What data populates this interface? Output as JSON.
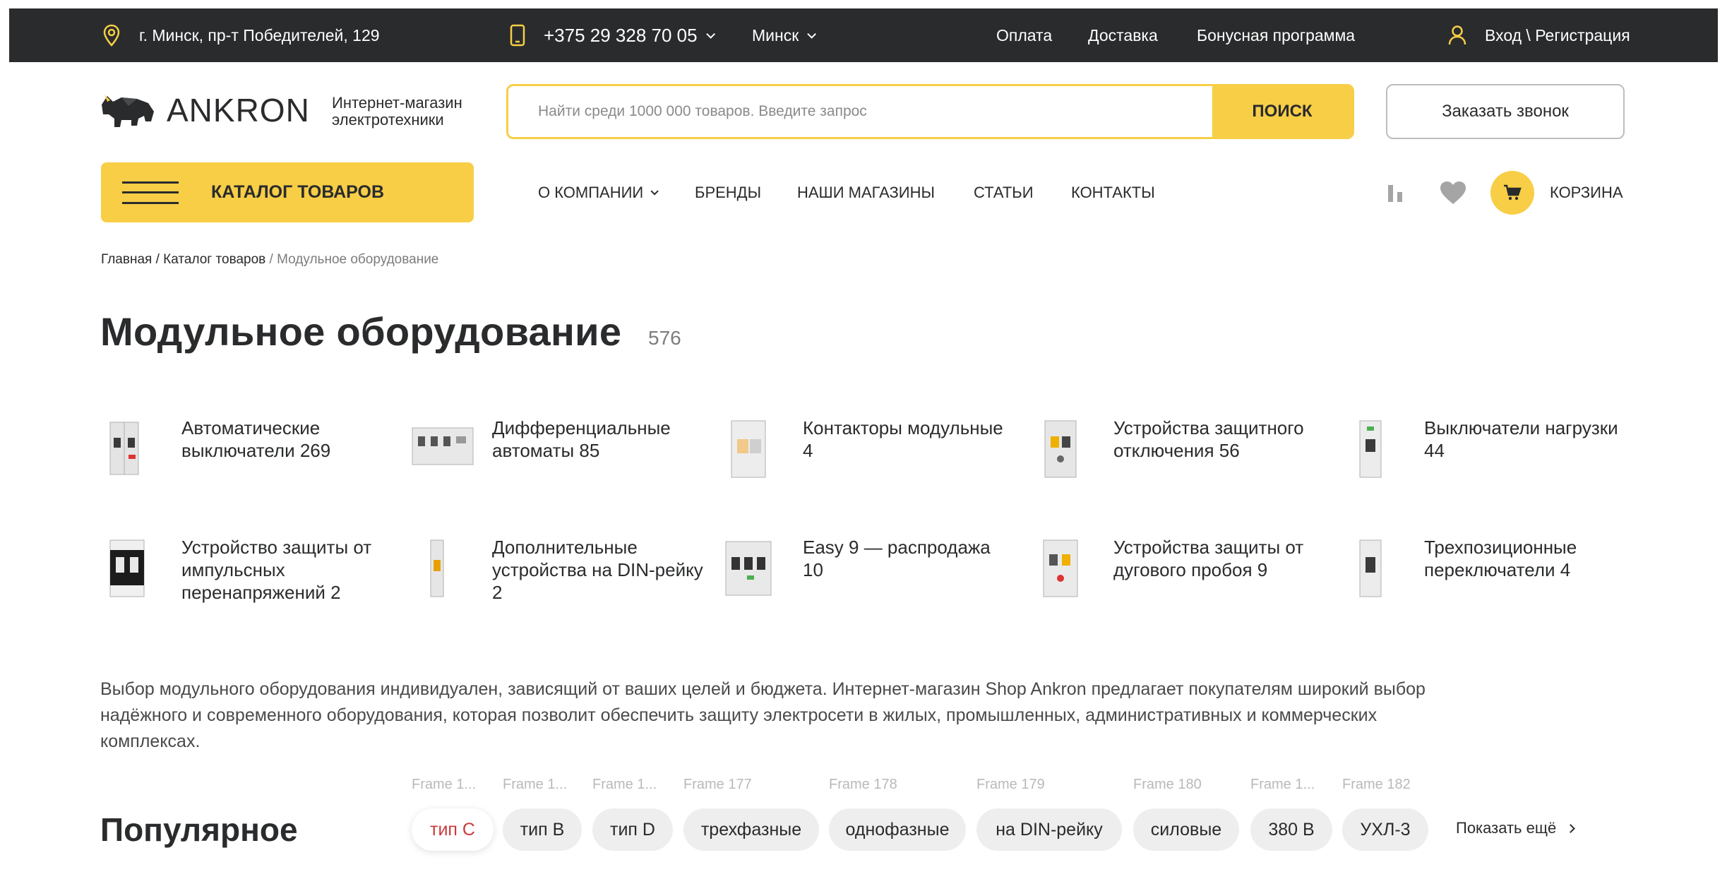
{
  "topbar": {
    "address": "г. Минск, пр-т Победителей, 129",
    "phone": "+375 29 328 70 05",
    "city": "Минск",
    "links": [
      "Оплата",
      "Доставка",
      "Бонусная программа"
    ],
    "account": "Вход \\ Регистрация"
  },
  "header": {
    "logo_text": "ANKRON",
    "tagline_1": "Интернет-магазин",
    "tagline_2": "электротехники",
    "search_placeholder": "Найти среди 1000 000 товаров. Введите запрос",
    "search_button": "ПОИСК",
    "callback_button": "Заказать звонок"
  },
  "nav": {
    "catalog": "КАТАЛОГ ТОВАРОВ",
    "items": [
      "О КОМПАНИИ",
      "БРЕНДЫ",
      "НАШИ МАГАЗИНЫ",
      "СТАТЬИ",
      "КОНТАКТЫ"
    ],
    "cart": "КОРЗИНА"
  },
  "breadcrumb": {
    "home": "Главная",
    "catalog": "Каталог товаров",
    "current": "Модульное оборудование"
  },
  "page": {
    "title": "Модульное оборудование",
    "count": "576"
  },
  "categories": [
    "Автоматические выключатели 269",
    "Дифференциальные автоматы 85",
    "Контакторы модульные 4",
    "Устройства защитного отключения 56",
    "Выключатели нагрузки 44",
    "Устройство защиты от импульсных перенапряжений 2",
    "Дополнительные устройства на DIN-рейку 2",
    "Easy 9 — распродажа 10",
    "Устройства защиты от дугового пробоя 9",
    "Трехпозиционные переключатели 4"
  ],
  "description": "Выбор модульного оборудования индивидуален, зависящий от ваших целей и бюджета. Интернет-магазин Shop Ankron предлагает покупателям широкий выбор надёжного и современного оборудования, которая позволит обеспечить защиту электросети в жилых, промышленных, административных и коммерческих комплексах.",
  "popular": {
    "title": "Популярное",
    "captions": [
      "Frame 1...",
      "Frame 1...",
      "Frame 1...",
      "Frame 177",
      "Frame 178",
      "Frame 179",
      "Frame 180",
      "Frame 1...",
      "Frame 182"
    ],
    "chips": [
      "тип С",
      "тип В",
      "тип D",
      "трехфазные",
      "однофазные",
      "на DIN-рейку",
      "силовые",
      "380 В",
      "УХЛ-3"
    ],
    "show_more": "Показать ещё"
  },
  "colors": {
    "accent": "#f7ce46",
    "topbar": "#2a2b2d",
    "active_chip_text": "#c83a3a"
  }
}
